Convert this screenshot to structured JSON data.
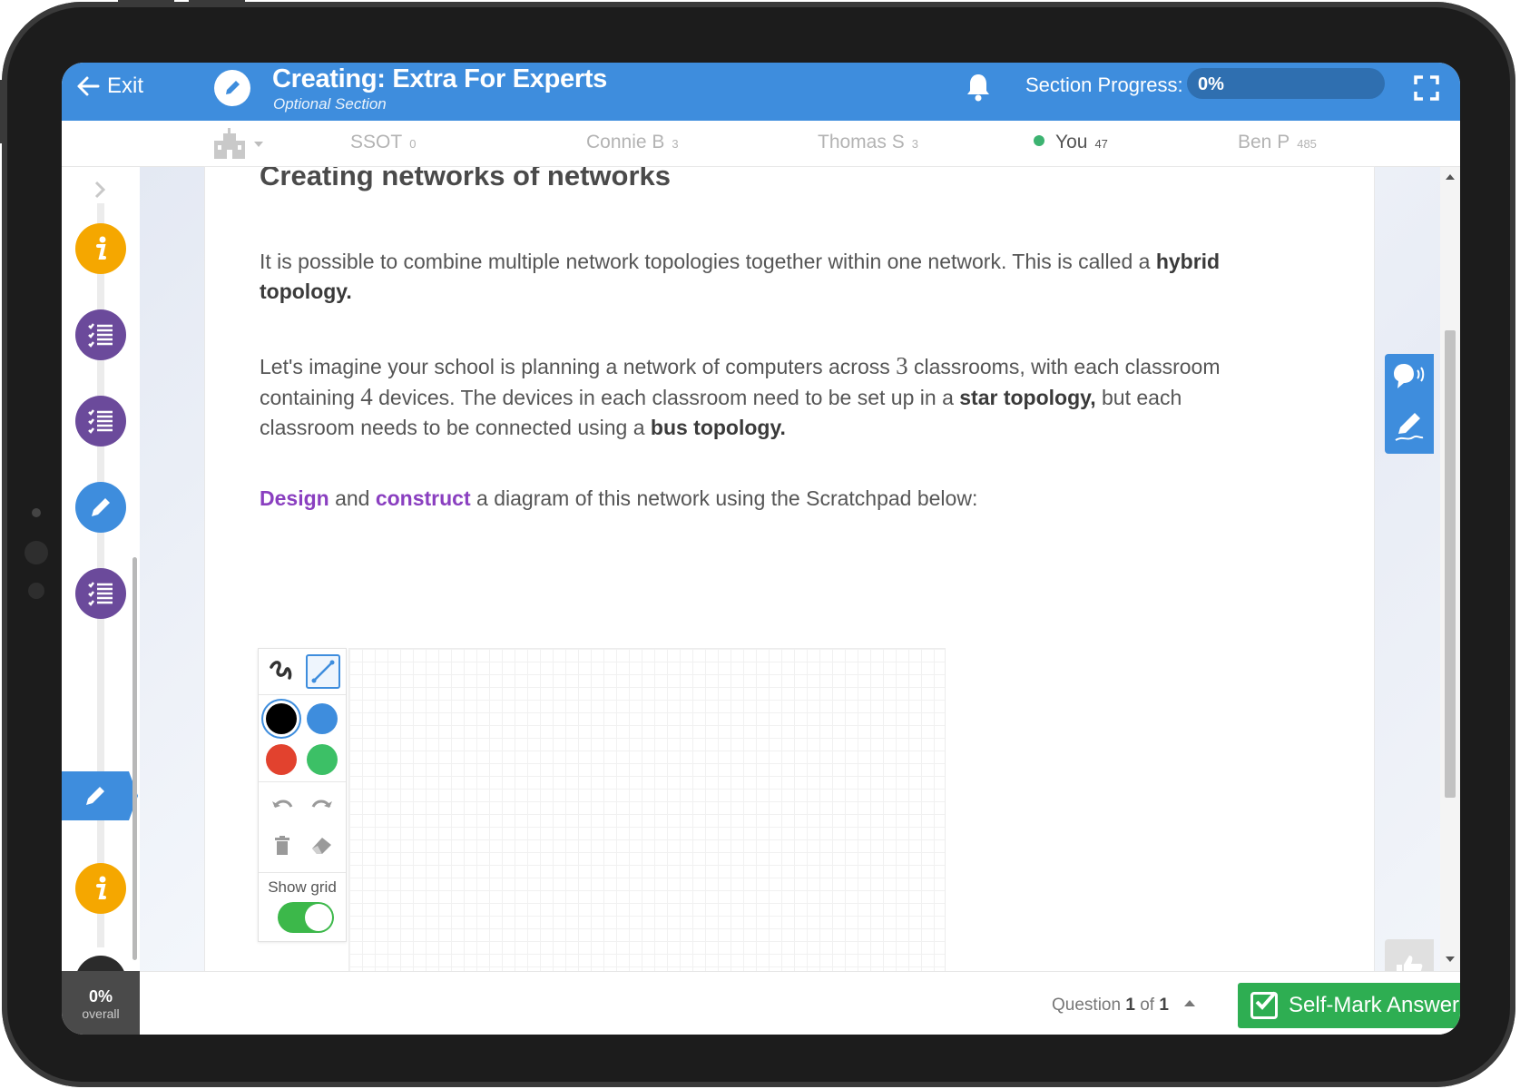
{
  "header": {
    "exit_label": "Exit",
    "title": "Creating: Extra For Experts",
    "subtitle": "Optional Section",
    "progress_label": "Section Progress:",
    "progress_value": "0%",
    "progress_fraction": 0
  },
  "leaderboard": [
    {
      "name": "SSOT",
      "score": "0"
    },
    {
      "name": "Connie B",
      "score": "3"
    },
    {
      "name": "Thomas S",
      "score": "3"
    },
    {
      "name": "You",
      "score": "47"
    },
    {
      "name": "Ben P",
      "score": "485"
    }
  ],
  "rail": {
    "steps": [
      "info-icon",
      "checklist-icon",
      "checklist-icon",
      "pencil-icon",
      "checklist-icon",
      "pencil-icon",
      "info-icon",
      "rocket-icon"
    ],
    "overall_value": "0%",
    "overall_label": "overall"
  },
  "content": {
    "heading": "Creating networks of networks",
    "p1_text": "It is possible to combine multiple network topologies together within one network. This is called a ",
    "p1_bold": "hybrid topology.",
    "p2_a": "Let's imagine your school is planning a network of computers across ",
    "p2_num1": "3",
    "p2_b": " classrooms, with each classroom containing ",
    "p2_num2": "4",
    "p2_c": " devices. The devices in each classroom need to be set up in a ",
    "p2_bold1": "star topology,",
    "p2_d": " but each classroom needs to be connected using a ",
    "p2_bold2": "bus topology.",
    "p3_word1": "Design",
    "p3_and": " and ",
    "p3_word2": "construct",
    "p3_rest": " a diagram of this network using the Scratchpad below:"
  },
  "scratchpad": {
    "show_grid_label": "Show grid",
    "colors": [
      "#000000",
      "#3e8ddd",
      "#e2422e",
      "#3cc066"
    ]
  },
  "footer": {
    "question_prefix": "Question",
    "question_num": "1",
    "question_mid": "of",
    "question_total": "1",
    "self_mark_label": "Self-Mark Answer"
  }
}
